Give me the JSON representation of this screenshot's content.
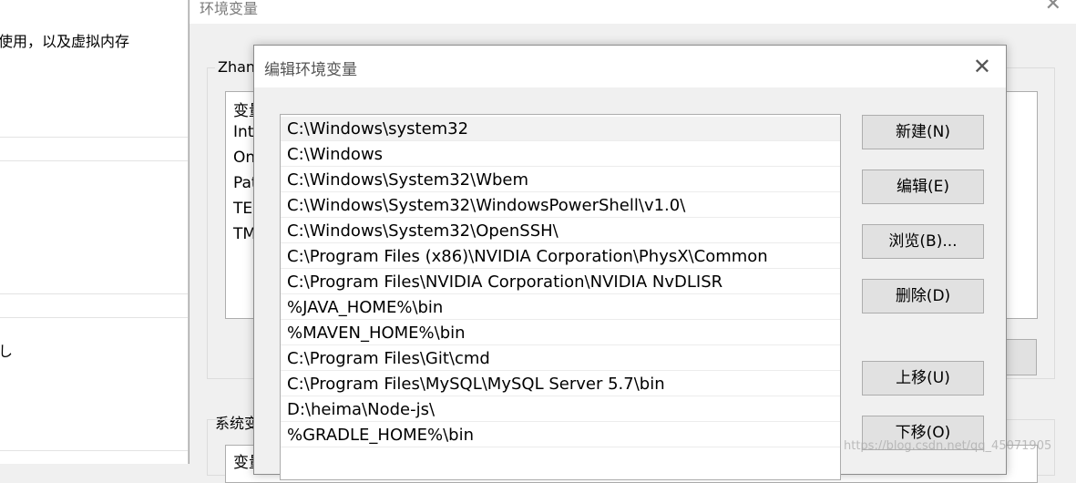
{
  "sysprops": {
    "line1": "使用，以及虚拟内存",
    "line2": "し"
  },
  "envwin": {
    "title": "环境变量",
    "close": "✕",
    "user_group_label": "Zhan",
    "user_list_header": "变量",
    "user_rows": [
      "Int",
      "On",
      "Pat",
      "TE",
      "TM"
    ],
    "system_group_label": "系统变",
    "system_list_header": "变量"
  },
  "dialog": {
    "title": "编辑环境变量",
    "close": "✕",
    "paths": [
      "C:\\Windows\\system32",
      "C:\\Windows",
      "C:\\Windows\\System32\\Wbem",
      "C:\\Windows\\System32\\WindowsPowerShell\\v1.0\\",
      "C:\\Windows\\System32\\OpenSSH\\",
      "C:\\Program Files (x86)\\NVIDIA Corporation\\PhysX\\Common",
      "C:\\Program Files\\NVIDIA Corporation\\NVIDIA NvDLISR",
      "%JAVA_HOME%\\bin",
      "%MAVEN_HOME%\\bin",
      "C:\\Program Files\\Git\\cmd",
      "C:\\Program Files\\MySQL\\MySQL Server 5.7\\bin",
      "D:\\heima\\Node-js\\",
      "%GRADLE_HOME%\\bin"
    ],
    "buttons": {
      "new": "新建(N)",
      "edit": "编辑(E)",
      "browse": "浏览(B)...",
      "delete": "删除(D)",
      "move_up": "上移(U)",
      "move_down": "下移(O)"
    }
  },
  "watermark": "https://blog.csdn.net/qq_45071905"
}
